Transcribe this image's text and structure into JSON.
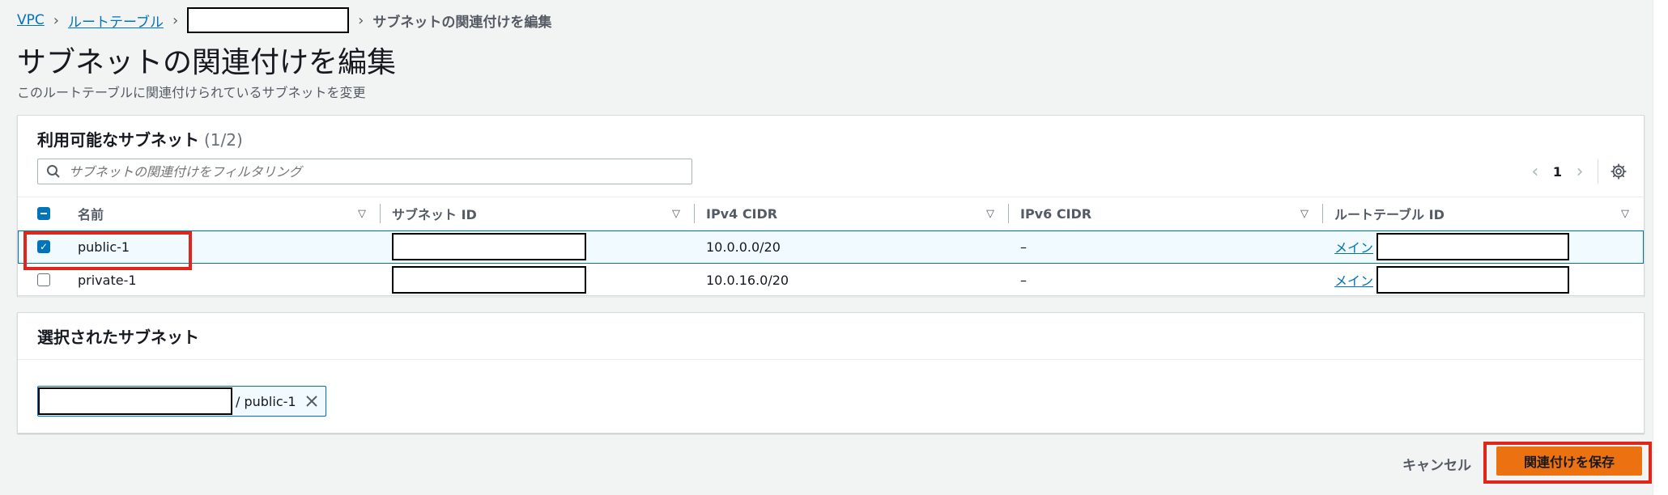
{
  "breadcrumb": {
    "vpc": "VPC",
    "route_tables": "ルートテーブル",
    "current": "サブネットの関連付けを編集"
  },
  "page": {
    "title": "サブネットの関連付けを編集",
    "description": "このルートテーブルに関連付けられているサブネットを変更"
  },
  "available": {
    "title": "利用可能なサブネット",
    "count": "(1/2)",
    "filter_placeholder": "サブネットの関連付けをフィルタリング",
    "page_number": "1",
    "columns": [
      "名前",
      "サブネット ID",
      "IPv4 CIDR",
      "IPv6 CIDR",
      "ルートテーブル ID"
    ],
    "rows": [
      {
        "name": "public-1",
        "ipv4": "10.0.0.0/20",
        "ipv6": "–",
        "route_table": "メイン",
        "checked": true
      },
      {
        "name": "private-1",
        "ipv4": "10.0.16.0/20",
        "ipv6": "–",
        "route_table": "メイン",
        "checked": false
      }
    ]
  },
  "selected": {
    "title": "選択されたサブネット",
    "token_label": "/ public-1"
  },
  "footer": {
    "cancel": "キャンセル",
    "save": "関連付けを保存"
  },
  "colors": {
    "link": "#0073bb",
    "primary_button": "#ec7211",
    "highlight": "#e0251b"
  },
  "icons": [
    "chevron-right-icon",
    "search-icon",
    "chevron-left-icon",
    "gear-icon",
    "sort-icon",
    "close-icon"
  ]
}
